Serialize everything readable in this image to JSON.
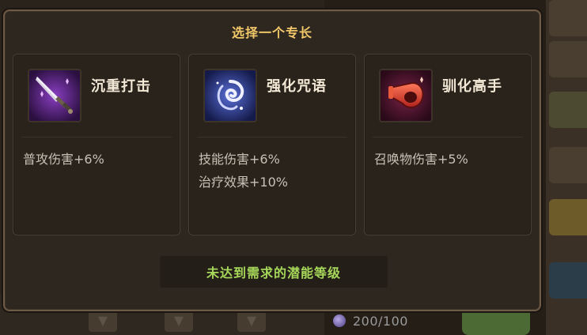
{
  "modal": {
    "title": "选择一个专长",
    "status_text": "未达到需求的潜能等级"
  },
  "cards": [
    {
      "name": "沉重打击",
      "icon": "sword-icon",
      "effects": [
        "普攻伤害+6%"
      ]
    },
    {
      "name": "强化咒语",
      "icon": "swirl-spell-icon",
      "effects": [
        "技能伤害+6%",
        "治疗效果+10%"
      ]
    },
    {
      "name": "驯化高手",
      "icon": "whistle-icon",
      "effects": [
        "召唤物伤害+5%"
      ]
    }
  ],
  "background": {
    "resource_count": "200/100",
    "colors": {
      "accent": "#f2c868",
      "status_green": "#a7d85a",
      "border": "#6e5b45"
    }
  }
}
